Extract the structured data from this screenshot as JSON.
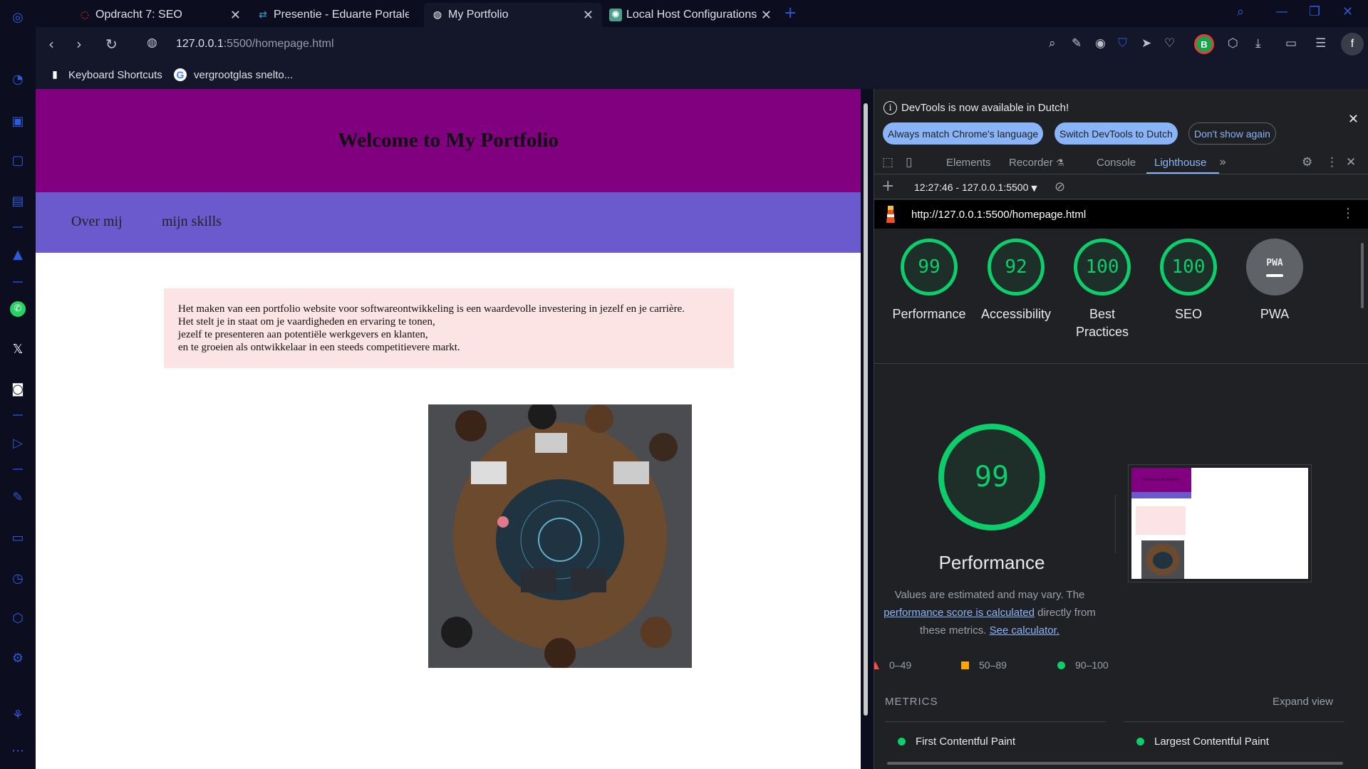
{
  "browser": {
    "tabs": [
      {
        "title": "Opdracht 7: SEO",
        "icon": "opera-icon"
      },
      {
        "title": "Presentie - Eduarte Portaler",
        "icon": "eduarte-icon"
      },
      {
        "title": "My Portfolio",
        "icon": "globe-icon"
      },
      {
        "title": "Local Host Configurations",
        "icon": "chatgpt-icon"
      }
    ],
    "url_host": "127.0.0.1",
    "url_rest": ":5500/homepage.html",
    "profile_initial": "B",
    "user_initial": "f",
    "bookmarks": [
      {
        "label": "Keyboard Shortcuts",
        "icon": "page-icon"
      },
      {
        "label": "vergrootglas snelto...",
        "icon": "google-icon"
      }
    ],
    "accent_color": "#2b5bd9"
  },
  "page": {
    "title": "Welcome to My Portfolio",
    "nav": [
      "Over mij",
      "mijn skills"
    ],
    "intro_lines": [
      "Het maken van een portfolio website voor softwareontwikkeling is een waardevolle investering in jezelf en je carrière.",
      "Het stelt je in staat om je vaardigheden en ervaring te tonen,",
      "jezelf te presenteren aan potentiële werkgevers en klanten,",
      "en te groeien als ontwikkelaar in een steeds competitievere markt."
    ],
    "header_color": "#800080",
    "nav_color": "#6a5acd",
    "intro_bg": "#fce4e4"
  },
  "devtools": {
    "info": {
      "message": "DevTools is now available in Dutch!",
      "btn_always": "Always match Chrome's language",
      "btn_switch": "Switch DevTools to Dutch",
      "btn_dont": "Don't show again"
    },
    "tabs": [
      "Elements",
      "Recorder",
      "Console",
      "Lighthouse"
    ],
    "active_tab": "Lighthouse",
    "report": "12:27:46 - 127.0.0.1:5500",
    "audited_url": "http://127.0.0.1:5500/homepage.html",
    "scores": [
      {
        "label": "Performance",
        "value": "99"
      },
      {
        "label": "Accessibility",
        "value": "92"
      },
      {
        "label": "Best Practices",
        "value": "100"
      },
      {
        "label": "SEO",
        "value": "100"
      },
      {
        "label": "PWA",
        "value": "PWA"
      }
    ],
    "perf": {
      "score": "99",
      "title": "Performance",
      "note_pre": "Values are estimated and may vary. The",
      "note_link": "performance score is calculated",
      "note_mid": "directly from these metrics.",
      "note_calc": "See calculator.",
      "legend": [
        "0–49",
        "50–89",
        "90–100"
      ]
    },
    "metrics_header": "METRICS",
    "expand_label": "Expand view",
    "metrics": [
      "First Contentful Paint",
      "Largest Contentful Paint"
    ],
    "good_color": "#0cce6b",
    "average_color": "#ffa400",
    "poor_color": "#ff4e42"
  }
}
